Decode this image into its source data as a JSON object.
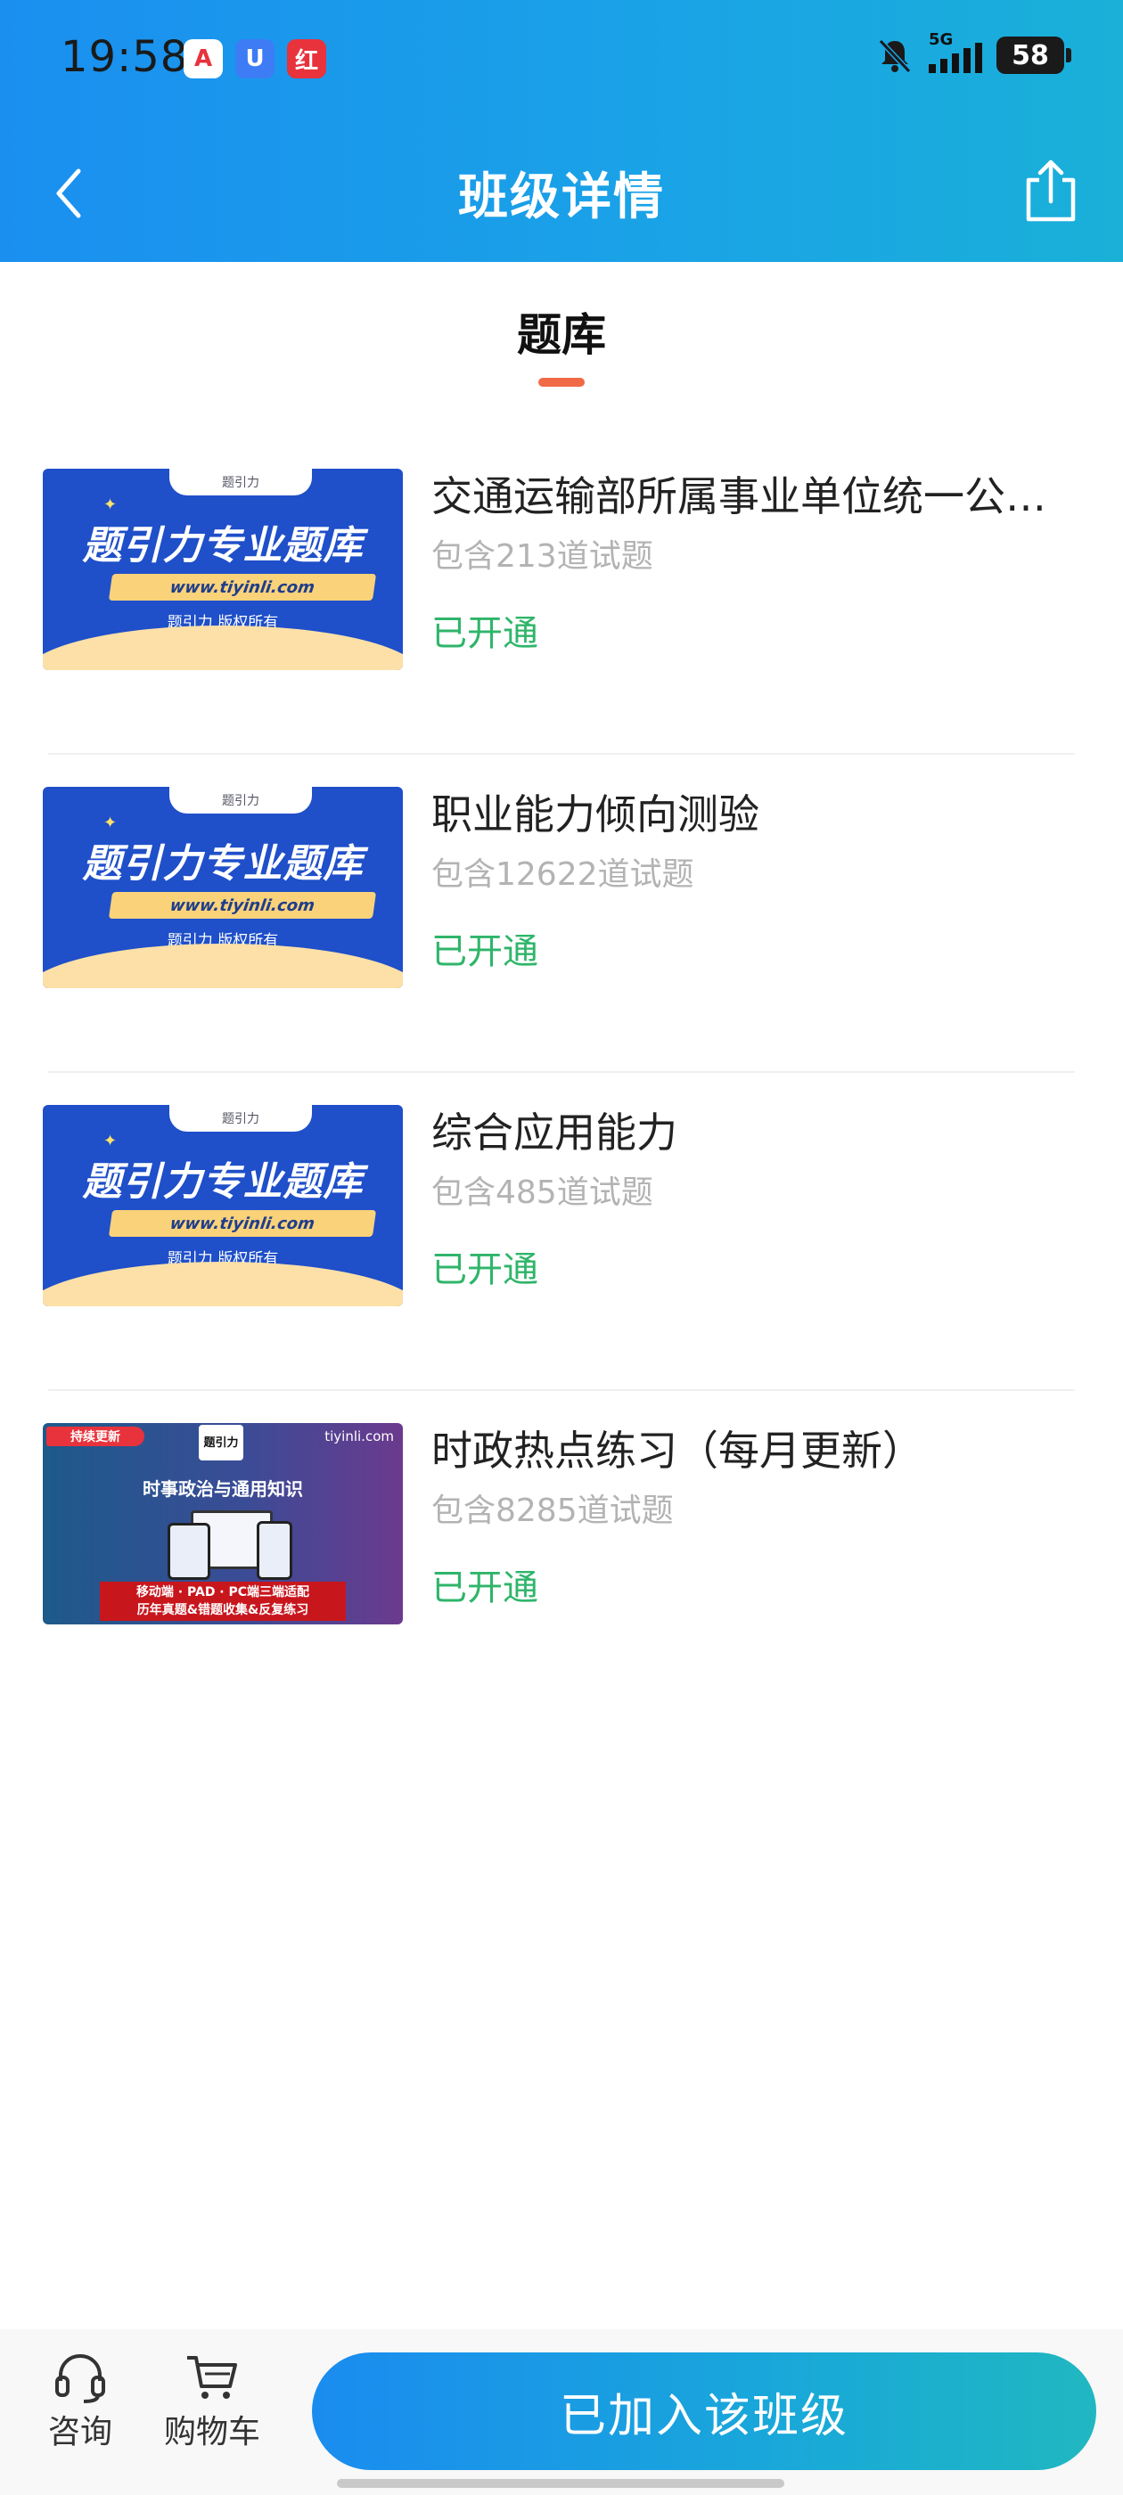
{
  "status_bar": {
    "time": "19:58",
    "apps": [
      {
        "name": "app-a-icon",
        "glyph": "A"
      },
      {
        "name": "app-u-icon",
        "glyph": "U"
      },
      {
        "name": "app-r-icon",
        "glyph": "红"
      }
    ],
    "network": "5G",
    "battery": "58"
  },
  "nav": {
    "title": "班级详情"
  },
  "tab": {
    "label": "题库"
  },
  "items": [
    {
      "title": "交通运输部所属事业单位统一公开招聘",
      "count": "包含213道试题",
      "status": "已开通",
      "thumb": {
        "headline": "题引力专业题库",
        "url": "www.tiyinli.com",
        "copyright": "题引力 版权所有",
        "brand": "题引力"
      }
    },
    {
      "title": "职业能力倾向测验",
      "count": "包含12622道试题",
      "status": "已开通",
      "thumb": {
        "headline": "题引力专业题库",
        "url": "www.tiyinli.com",
        "copyright": "题引力 版权所有",
        "brand": "题引力"
      }
    },
    {
      "title": "综合应用能力",
      "count": "包含485道试题",
      "status": "已开通",
      "thumb": {
        "headline": "题引力专业题库",
        "url": "www.tiyinli.com",
        "copyright": "题引力 版权所有",
        "brand": "题引力"
      }
    },
    {
      "title": "时政热点练习（每月更新）",
      "count": "包含8285道试题",
      "status": "已开通",
      "thumb": {
        "badge": "持续更新",
        "logo": "题引力",
        "site": "tiyinli.com",
        "subtitle": "时事政治与通用知识",
        "line1": "移动端 · PAD · PC端三端适配",
        "line2": "历年真题&错题收集&反复练习"
      }
    }
  ],
  "bottom_bar": {
    "consult_label": "咨询",
    "cart_label": "购物车",
    "join_label": "已加入该班级"
  },
  "colors": {
    "header_gradient_start": "#1a8ff0",
    "header_gradient_end": "#1ab0d8",
    "tab_indicator": "#f06a46",
    "status_green": "#2fb56a",
    "count_gray": "#b3b3b3"
  }
}
